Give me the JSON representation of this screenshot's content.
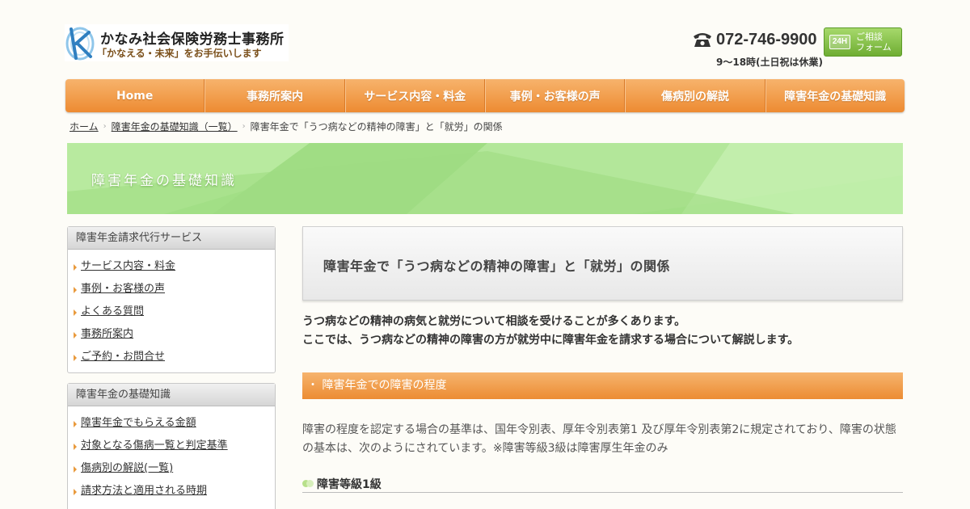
{
  "header": {
    "logo_name": "かなみ社会保険労務士事務所",
    "logo_tagline": "「かなえる・未来」をお手伝いします",
    "phone": "072-746-9900",
    "hours": "9〜18時(土日祝は休業)",
    "consult_badge": "24H",
    "consult_label": "ご相談\nフォーム",
    "accent_color": "#ed8b32"
  },
  "nav": {
    "items": [
      {
        "label": "Home"
      },
      {
        "label": "事務所案内"
      },
      {
        "label": "サービス内容・料金"
      },
      {
        "label": "事例・お客様の声"
      },
      {
        "label": "傷病別の解説"
      },
      {
        "label": "障害年金の基礎知識"
      }
    ]
  },
  "breadcrumb": {
    "home": "ホーム",
    "parent": "障害年金の基礎知識（一覧）",
    "current": "障害年金で「うつ病などの精神の障害」と「就労」の関係"
  },
  "banner": {
    "title": "障害年金の基礎知識"
  },
  "sidebar": {
    "boxes": [
      {
        "heading": "障害年金請求代行サービス",
        "items": [
          {
            "label": "サービス内容・料金"
          },
          {
            "label": "事例・お客様の声"
          },
          {
            "label": "よくある質問"
          },
          {
            "label": "事務所案内"
          },
          {
            "label": "ご予約・お問合せ"
          }
        ]
      },
      {
        "heading": "障害年金の基礎知識",
        "items": [
          {
            "label": "障害年金でもらえる金額"
          },
          {
            "label": "対象となる傷病一覧と判定基準"
          },
          {
            "label": "傷病別の解説(一覧)"
          },
          {
            "label": "請求方法と適用される時期"
          }
        ]
      }
    ]
  },
  "main": {
    "title": "障害年金で「うつ病などの精神の障害」と「就労」の関係",
    "intro_line1": "うつ病などの精神の病気と就労について相談を受けることが多くあります。",
    "intro_line2": "ここでは、うつ病などの精神の障害の方が就労中に障害年金を請求する場合について解説します。",
    "section_title": "・ 障害年金での障害の程度",
    "paragraph": "障害の程度を認定する場合の基準は、国年令別表、厚年令別表第1 及び厚年令別表第2に規定されており、障害の状態の基本は、次のようにされています。※障害等級3級は障害厚生年金のみ",
    "subheading": "障害等級1級"
  }
}
